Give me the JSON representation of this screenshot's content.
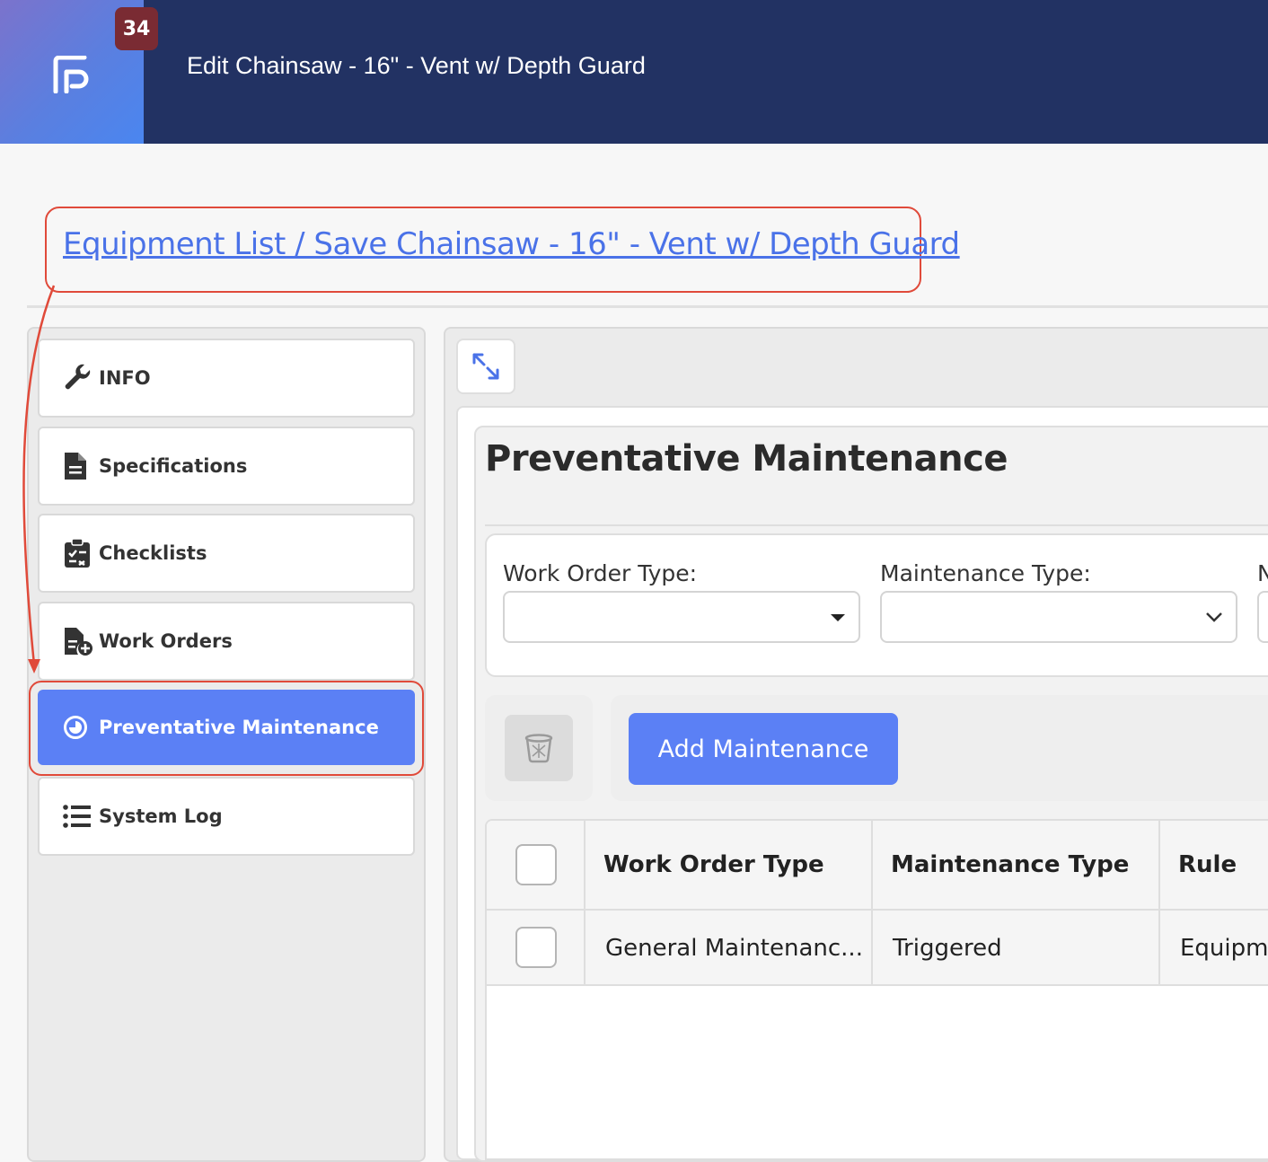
{
  "header": {
    "badge_count": "34",
    "window_title": "Edit Chainsaw - 16\" - Vent w/ Depth Guard",
    "colors": {
      "bar": "#223263",
      "badge": "#7a2b33"
    }
  },
  "breadcrumb": "Equipment List / Save Chainsaw - 16\" - Vent w/ Depth Guard",
  "sidebar": {
    "items": [
      {
        "label": "INFO",
        "icon": "wrench-icon"
      },
      {
        "label": "Specifications",
        "icon": "document-icon"
      },
      {
        "label": "Checklists",
        "icon": "clipboard-icon"
      },
      {
        "label": "Work Orders",
        "icon": "work-order-icon"
      },
      {
        "label": "Preventative Maintenance",
        "icon": "clock-icon",
        "active": true
      },
      {
        "label": "System Log",
        "icon": "list-icon"
      }
    ],
    "active_color": "#5b80f5"
  },
  "main": {
    "title": "Preventative Maintenance",
    "filters": {
      "work_order_type_label": "Work Order Type:",
      "work_order_type_value": "",
      "maintenance_type_label": "Maintenance Type:",
      "maintenance_type_value": "",
      "third_label_partial": "N"
    },
    "add_button": "Add Maintenance",
    "table": {
      "columns": [
        "Work Order Type",
        "Maintenance Type",
        "Rule"
      ],
      "rows": [
        {
          "work_order_type": "General Maintenanc...",
          "maintenance_type": "Triggered",
          "rule": "Equipme"
        }
      ]
    }
  },
  "annotations": {
    "highlight_color": "#e04a3a"
  }
}
